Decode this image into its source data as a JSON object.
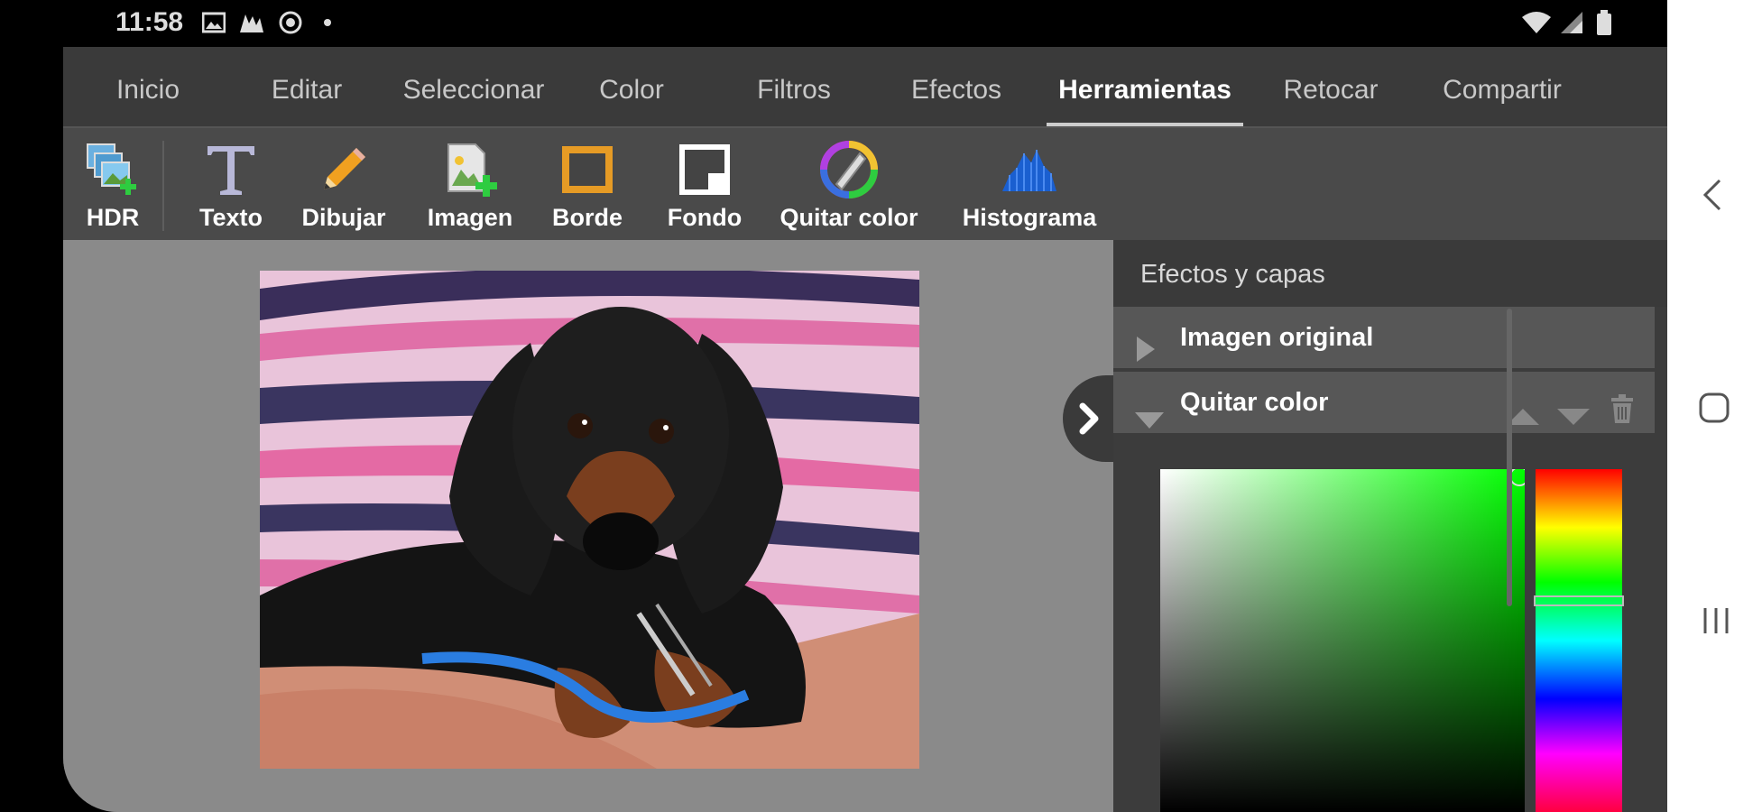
{
  "status_bar": {
    "time": "11:58"
  },
  "tabs": [
    {
      "label": "Inicio"
    },
    {
      "label": "Editar"
    },
    {
      "label": "Seleccionar"
    },
    {
      "label": "Color"
    },
    {
      "label": "Filtros"
    },
    {
      "label": "Efectos"
    },
    {
      "label": "Herramientas",
      "active": true
    },
    {
      "label": "Retocar"
    },
    {
      "label": "Compartir"
    }
  ],
  "toolbar": {
    "items": [
      {
        "label": "HDR",
        "icon": "hdr-icon"
      },
      {
        "label": "Texto",
        "icon": "text-icon"
      },
      {
        "label": "Dibujar",
        "icon": "pencil-icon"
      },
      {
        "label": "Imagen",
        "icon": "add-image-icon"
      },
      {
        "label": "Borde",
        "icon": "border-icon"
      },
      {
        "label": "Fondo",
        "icon": "background-icon"
      },
      {
        "label": "Quitar color",
        "icon": "remove-color-icon"
      },
      {
        "label": "Histograma",
        "icon": "histogram-icon"
      }
    ]
  },
  "panel": {
    "title": "Efectos y capas",
    "layers": [
      {
        "name": "Imagen original",
        "expanded": false
      },
      {
        "name": "Quitar color",
        "expanded": true
      }
    ]
  },
  "colors": {
    "accent_selected_color": "#00ff00",
    "app_background": "#444444",
    "canvas_background": "#8a8a8a"
  }
}
